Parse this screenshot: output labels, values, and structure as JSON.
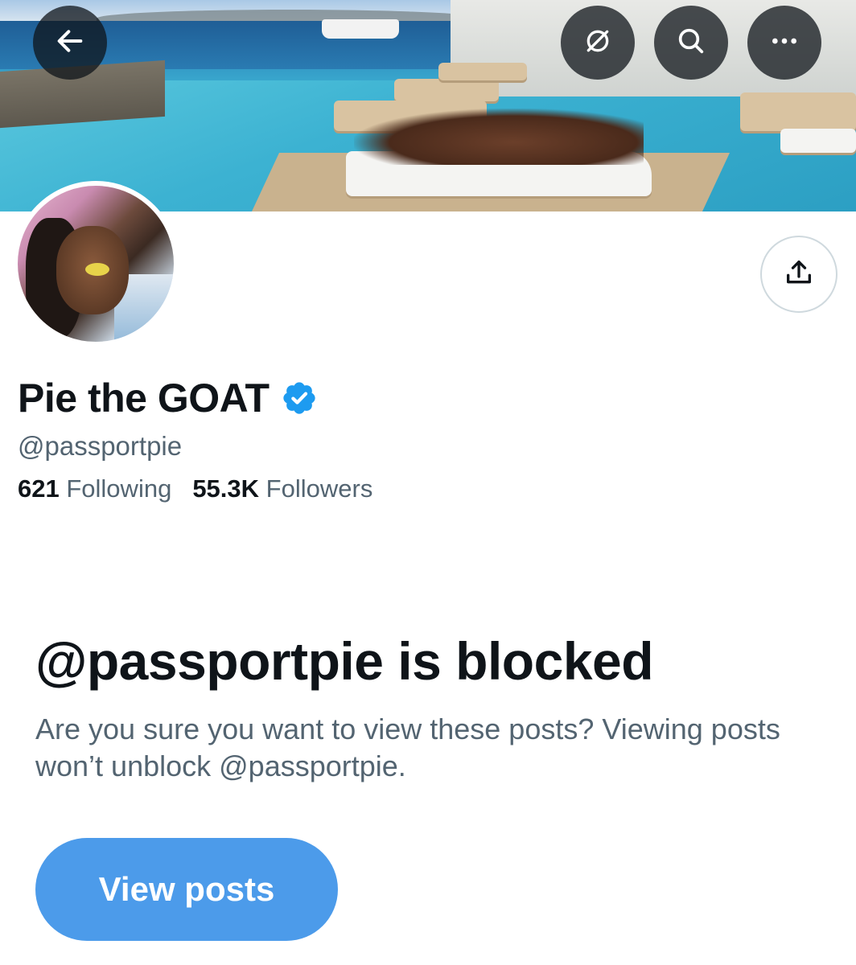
{
  "header": {
    "back_icon": "arrow-left-icon",
    "translate_icon": "translate-slash-icon",
    "search_icon": "search-icon",
    "more_icon": "more-horizontal-icon",
    "overlay_color": "#0f1419"
  },
  "profile": {
    "display_name": "Pie the GOAT",
    "verified_icon": "verified-badge-icon",
    "verified_color": "#1d9bf0",
    "handle": "@passportpie",
    "following_count": "621",
    "following_label": "Following",
    "followers_count": "55.3K",
    "followers_label": "Followers",
    "share_icon": "share-icon"
  },
  "blocked": {
    "title": "@passportpie is blocked",
    "description": "Are you sure you want to view these posts? Viewing posts won’t unblock @passportpie.",
    "button_label": "View posts",
    "button_color": "#4c9bea"
  },
  "colors": {
    "text_primary": "#0f1419",
    "text_secondary": "#536471"
  }
}
